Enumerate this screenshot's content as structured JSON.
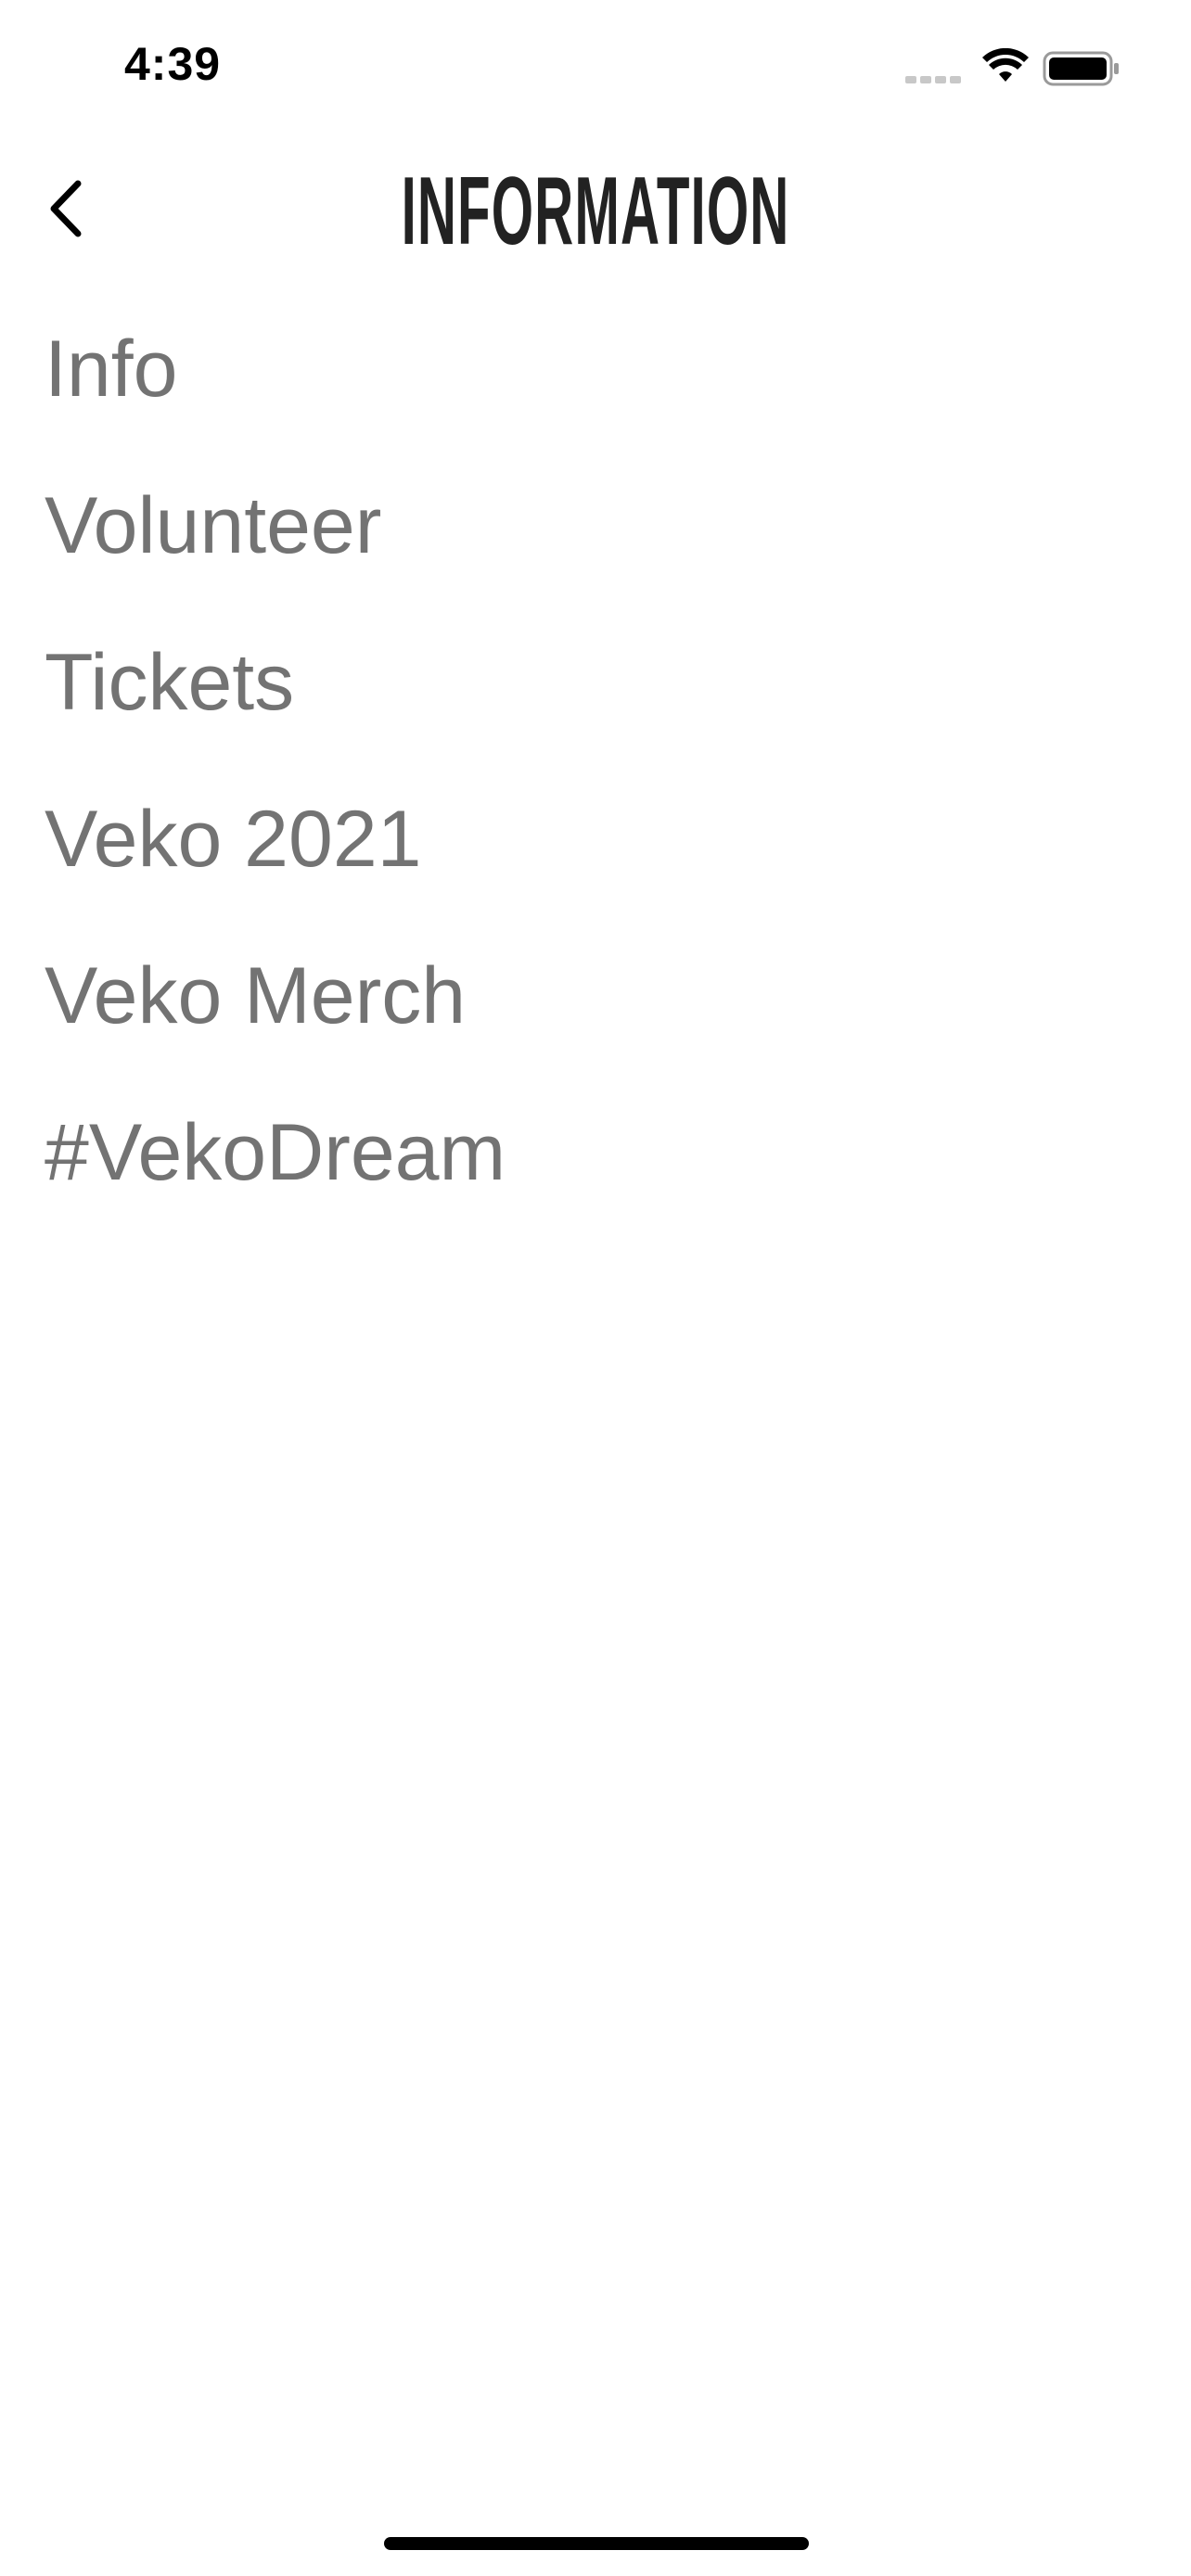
{
  "status_bar": {
    "time": "4:39",
    "signal_icon": "cellular-signal-icon",
    "wifi_icon": "wifi-icon",
    "battery_icon": "battery-icon"
  },
  "header": {
    "back_icon": "chevron-left-icon",
    "title": "INFORMATION"
  },
  "menu": {
    "items": [
      {
        "label": "Info"
      },
      {
        "label": "Volunteer"
      },
      {
        "label": "Tickets"
      },
      {
        "label": "Veko 2021"
      },
      {
        "label": "Veko Merch"
      },
      {
        "label": "#VekoDream"
      }
    ]
  },
  "colors": {
    "background": "#ffffff",
    "title": "#222222",
    "menu_text": "#737373",
    "icon": "#000000"
  }
}
